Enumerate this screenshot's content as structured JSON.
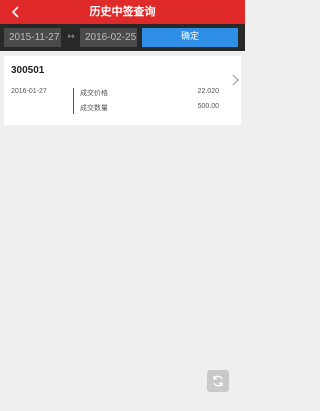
{
  "header": {
    "title": "历史中签查询",
    "back_icon": "chevron-left-icon"
  },
  "filter": {
    "start_date": "2015-11-27",
    "range_arrow": "↔",
    "end_date": "2016-02-25",
    "confirm_label": "确定"
  },
  "records": [
    {
      "code": "300501",
      "date": "2016-01-27",
      "price_label": "成交价格",
      "price_value": "22.020",
      "qty_label": "成交数量",
      "qty_value": "500.00"
    }
  ],
  "footer": {
    "refresh_icon": "refresh-icon"
  },
  "colors": {
    "header": "#e02a2a",
    "accent": "#2f8fe6",
    "filter_bar": "#282828",
    "background": "#efefef"
  }
}
